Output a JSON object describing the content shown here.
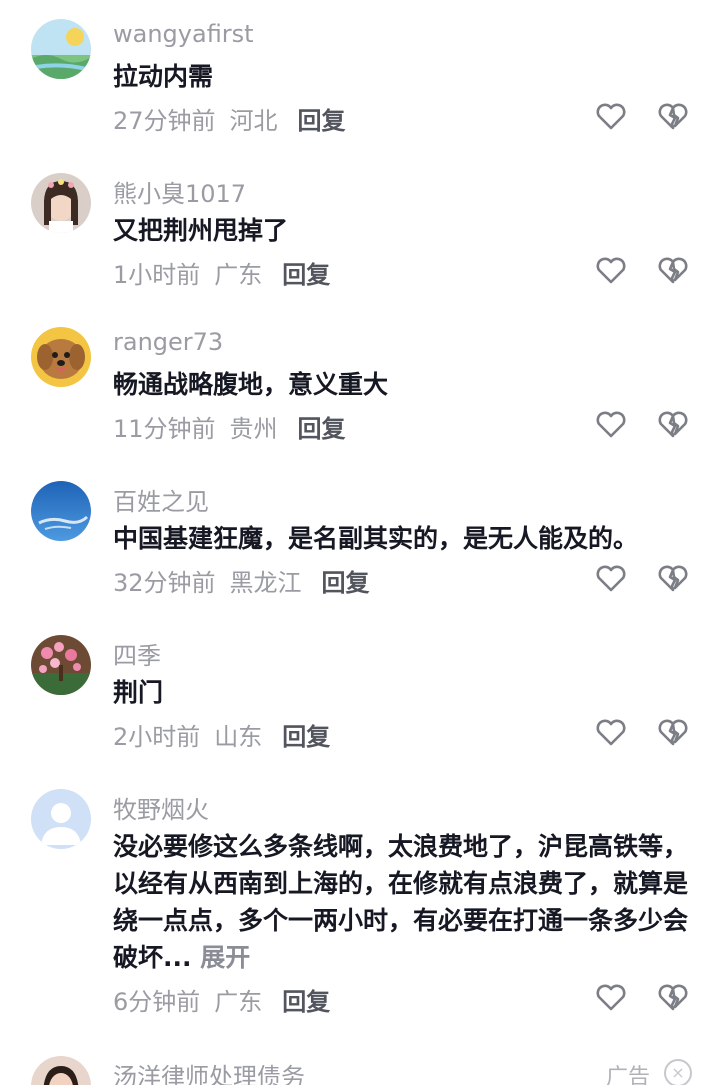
{
  "comments": [
    {
      "username": "wangyafirst",
      "text": "拉动内需",
      "time": "27分钟前",
      "location": "河北",
      "reply_label": "回复"
    },
    {
      "username": "熊小臭1017",
      "text": "又把荆州甩掉了",
      "time": "1小时前",
      "location": "广东",
      "reply_label": "回复"
    },
    {
      "username": "ranger73",
      "text": "畅通战略腹地，意义重大",
      "time": "11分钟前",
      "location": "贵州",
      "reply_label": "回复"
    },
    {
      "username": "百姓之见",
      "text": "中国基建狂魔，是名副其实的，是无人能及的。",
      "time": "32分钟前",
      "location": "黑龙江",
      "reply_label": "回复"
    },
    {
      "username": "四季",
      "text": "荆门",
      "time": "2小时前",
      "location": "山东",
      "reply_label": "回复"
    },
    {
      "username": "牧野烟火",
      "text": "没必要修这么多条线啊，太浪费地了，沪昆高铁等，以经有从西南到上海的，在修就有点浪费了，就算是绕一点点，多个一两小时，有必要在打通一条多少会破坏...",
      "expand_label": "展开",
      "time": "6分钟前",
      "location": "广东",
      "reply_label": "回复"
    }
  ],
  "ad": {
    "username": "汤洋律师处理债务",
    "badge": "广告",
    "close_icon": "×"
  },
  "icons": {
    "like": "heart-outline-icon",
    "dislike": "broken-heart-icon"
  }
}
